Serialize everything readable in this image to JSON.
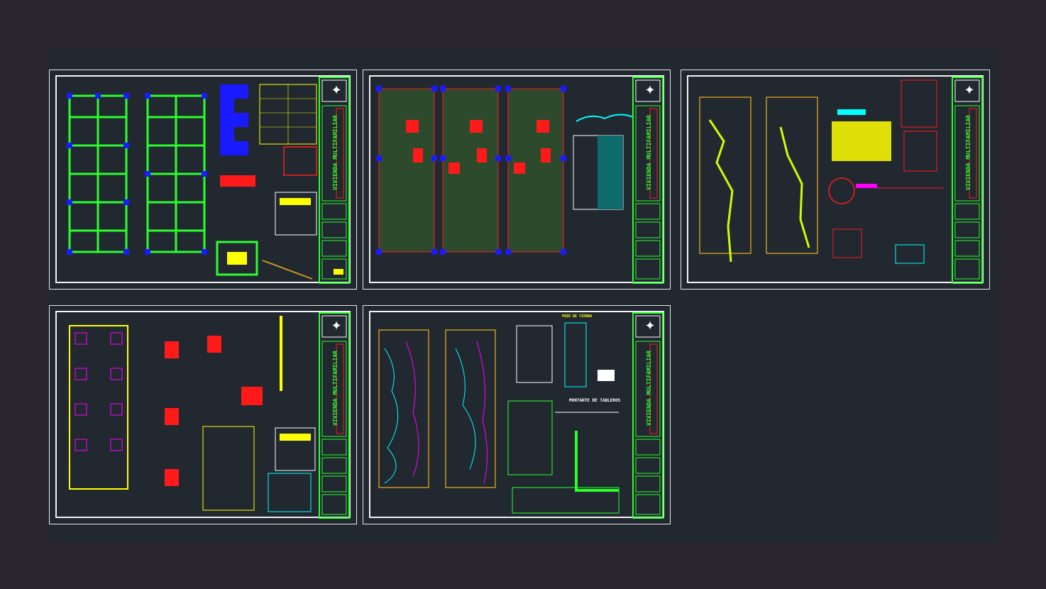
{
  "viewport": {
    "background": "#2a272f",
    "model_space_background": "#212830"
  },
  "colors": {
    "frame": "#f2f2f2",
    "green": "#2bff2b",
    "red": "#ff1a1a",
    "blue": "#1a1aff",
    "yellow": "#ffff00",
    "orange": "#c8961e",
    "cyan": "#00ffff",
    "magenta": "#ff00ff",
    "white": "#ffffff"
  },
  "sheets": [
    {
      "id": "sheet-1",
      "title_block_text": "VIVIENDA MULTIFAMILIAR",
      "discipline": "structural-plans"
    },
    {
      "id": "sheet-2",
      "title_block_text": "VIVIENDA MULTIFAMILIAR",
      "discipline": "architectural-plans"
    },
    {
      "id": "sheet-3",
      "title_block_text": "VIVIENDA MULTIFAMILIAR",
      "discipline": "sanitary-plans"
    },
    {
      "id": "sheet-4",
      "title_block_text": "VIVIENDA MULTIFAMILIAR",
      "discipline": "foundation-details"
    },
    {
      "id": "sheet-5",
      "title_block_text": "VIVIENDA MULTIFAMILIAR",
      "discipline": "electrical-plans"
    }
  ],
  "labels": {
    "sheet5_riser": "MONTANTE DE TABLEROS",
    "sheet5_pozo": "POZO DE TIERRA"
  },
  "icons": [
    "logo-icon"
  ]
}
